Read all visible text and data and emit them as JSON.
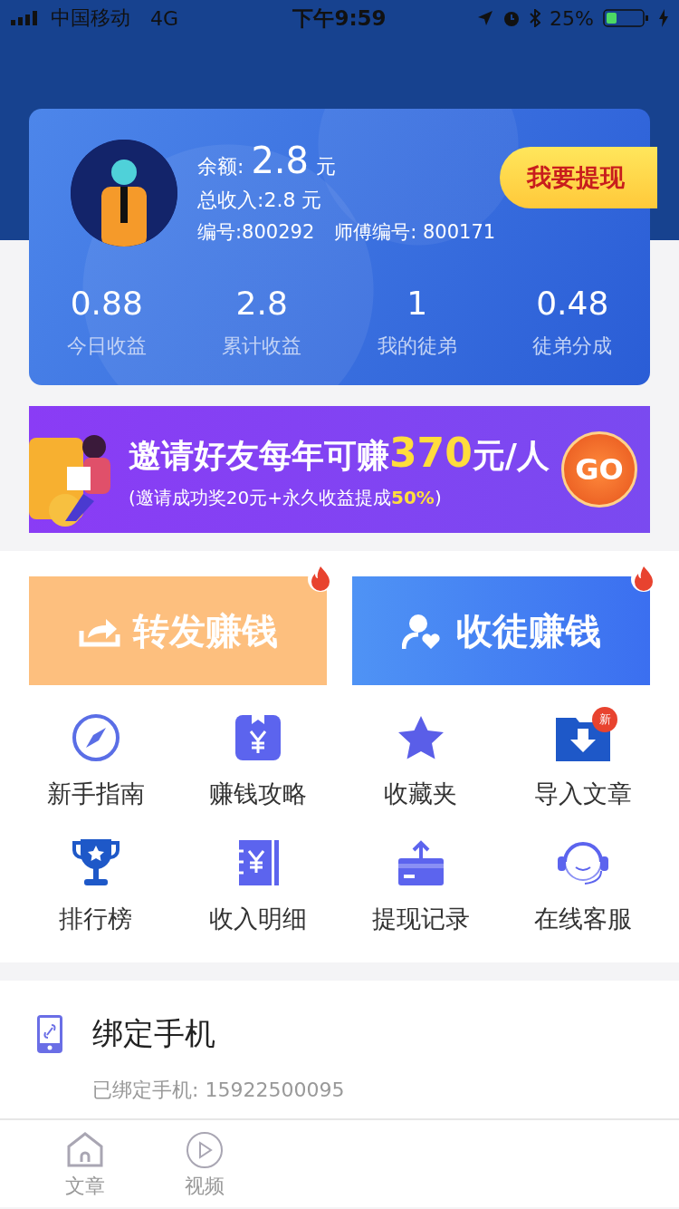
{
  "status_bar": {
    "carrier": "中国移动",
    "network": "4G",
    "time": "下午9:59",
    "battery": "25%"
  },
  "account": {
    "balance_label": "余额:",
    "balance": "2.8",
    "balance_unit": "元",
    "total_income": "总收入:2.8 元",
    "user_id": "编号:800292",
    "master_id": "师傅编号: 800171",
    "withdraw_button": "我要提现",
    "stats": [
      {
        "value": "0.88",
        "label": "今日收益"
      },
      {
        "value": "2.8",
        "label": "累计收益"
      },
      {
        "value": "1",
        "label": "我的徒弟"
      },
      {
        "value": "0.48",
        "label": "徒弟分成"
      }
    ]
  },
  "invite_banner": {
    "headline": "邀请好友每年可赚**370**元/人",
    "subline": "(邀请成功奖20元+永久收益提成**50%**)",
    "button": "GO"
  },
  "action_cards": [
    {
      "kind": "share",
      "label": "转发赚钱",
      "hot": true
    },
    {
      "kind": "recruit",
      "label": "收徒赚钱",
      "hot": true
    }
  ],
  "menu": [
    {
      "kind": "compass",
      "label": "新手指南"
    },
    {
      "kind": "money-book",
      "label": "赚钱攻略"
    },
    {
      "kind": "star",
      "label": "收藏夹"
    },
    {
      "kind": "import",
      "label": "导入文章",
      "badge": "新"
    },
    {
      "kind": "trophy",
      "label": "排行榜"
    },
    {
      "kind": "ledger",
      "label": "收入明细"
    },
    {
      "kind": "card",
      "label": "提现记录"
    },
    {
      "kind": "headset",
      "label": "在线客服"
    }
  ],
  "bind_phone": {
    "title": "绑定手机",
    "detail": "已绑定手机: 15922500095"
  },
  "tab_bar": [
    {
      "kind": "home",
      "label": "文章",
      "selected": false
    },
    {
      "kind": "play",
      "label": "视频",
      "selected": false
    }
  ]
}
